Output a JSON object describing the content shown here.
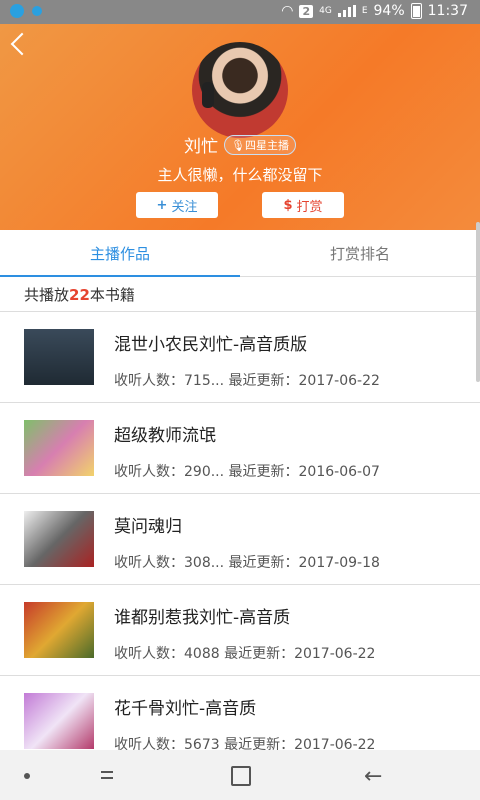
{
  "status_bar": {
    "badge": "2",
    "network": "4G",
    "network2": "4G",
    "mode": "E",
    "battery": "94%",
    "time": "11:37"
  },
  "header": {
    "name": "刘忙",
    "tag": "四星主播",
    "bio": "主人很懒，什么都没留下",
    "follow_label": "关注",
    "tip_label": "打赏",
    "colors": {
      "accent_orange": "#f57a28",
      "accent_blue": "#2d8fe1",
      "accent_red": "#e5432f"
    }
  },
  "tabs": [
    {
      "label": "主播作品"
    },
    {
      "label": "打赏排名"
    }
  ],
  "summary": {
    "prefix": "共播放",
    "count": "22",
    "suffix": "本书籍"
  },
  "books": [
    {
      "title": "混世小农民刘忙-高音质版",
      "meta": "收听人数：715... 最近更新：2017-06-22"
    },
    {
      "title": "超级教师流氓",
      "meta": "收听人数：290... 最近更新：2016-06-07"
    },
    {
      "title": "莫问魂归",
      "meta": "收听人数：308... 最近更新：2017-09-18"
    },
    {
      "title": "谁都别惹我刘忙-高音质",
      "meta": "收听人数：4088 最近更新：2017-06-22"
    },
    {
      "title": "花千骨刘忙-高音质",
      "meta": "收听人数：5673 最近更新：2017-06-22"
    }
  ]
}
